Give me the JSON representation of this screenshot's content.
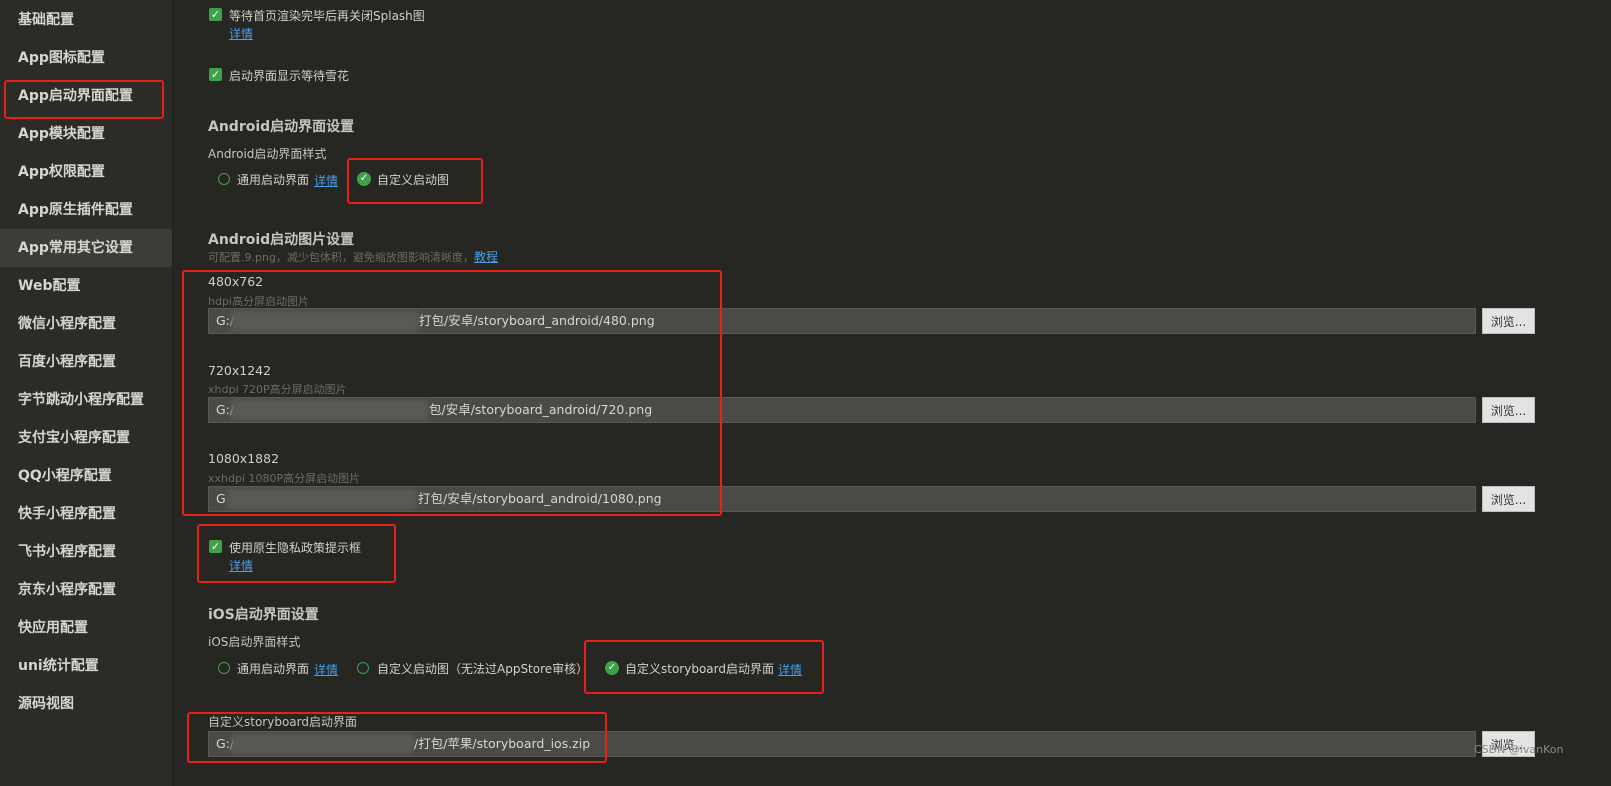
{
  "sidebar": {
    "items": [
      {
        "label": "基础配置"
      },
      {
        "label": "App图标配置"
      },
      {
        "label": "App启动界面配置"
      },
      {
        "label": "App模块配置"
      },
      {
        "label": "App权限配置"
      },
      {
        "label": "App原生插件配置"
      },
      {
        "label": "App常用其它设置"
      },
      {
        "label": "Web配置"
      },
      {
        "label": "微信小程序配置"
      },
      {
        "label": "百度小程序配置"
      },
      {
        "label": "字节跳动小程序配置"
      },
      {
        "label": "支付宝小程序配置"
      },
      {
        "label": "QQ小程序配置"
      },
      {
        "label": "快手小程序配置"
      },
      {
        "label": "飞书小程序配置"
      },
      {
        "label": "京东小程序配置"
      },
      {
        "label": "快应用配置"
      },
      {
        "label": "uni统计配置"
      },
      {
        "label": "源码视图"
      }
    ]
  },
  "main": {
    "splash_wait": {
      "label": "等待首页渲染完毕后再关闭Splash图",
      "detail": "详情"
    },
    "snowflake": {
      "label": "启动界面显示等待雪花"
    },
    "android": {
      "section_title": "Android启动界面设置",
      "style_label": "Android启动界面样式",
      "option_common": "通用启动界面",
      "option_common_detail": "详情",
      "option_custom": "自定义启动图",
      "images_title": "Android启动图片设置",
      "images_hint": "可配置.9.png，减少包体积，避免缩放图影响清晰度，",
      "images_hint_link": "教程",
      "images": [
        {
          "size": "480x762",
          "desc": "hdpi高分屏启动图片",
          "path_prefix": "G:/",
          "path_suffix": "打包/安卓/storyboard_android/480.png",
          "browse": "浏览..."
        },
        {
          "size": "720x1242",
          "desc": "xhdpi 720P高分屏启动图片",
          "path_prefix": "G:/",
          "path_suffix": "包/安卓/storyboard_android/720.png",
          "browse": "浏览..."
        },
        {
          "size": "1080x1882",
          "desc": "xxhdpi 1080P高分屏启动图片",
          "path_prefix": "G",
          "path_suffix": "打包/安卓/storyboard_android/1080.png",
          "browse": "浏览..."
        }
      ]
    },
    "privacy": {
      "label": "使用原生隐私政策提示框",
      "detail": "详情"
    },
    "ios": {
      "section_title": "iOS启动界面设置",
      "style_label": "iOS启动界面样式",
      "option_common": "通用启动界面",
      "option_common_detail": "详情",
      "option_custom_image": "自定义启动图（无法过AppStore审核）",
      "option_storyboard": "自定义storyboard启动界面",
      "option_storyboard_detail": "详情",
      "storyboard_label": "自定义storyboard启动界面",
      "storyboard_path_prefix": "G:/",
      "storyboard_path_suffix": "/打包/苹果/storyboard_ios.zip",
      "browse": "浏览..."
    },
    "watermark": "CSDN @ivanKon"
  }
}
